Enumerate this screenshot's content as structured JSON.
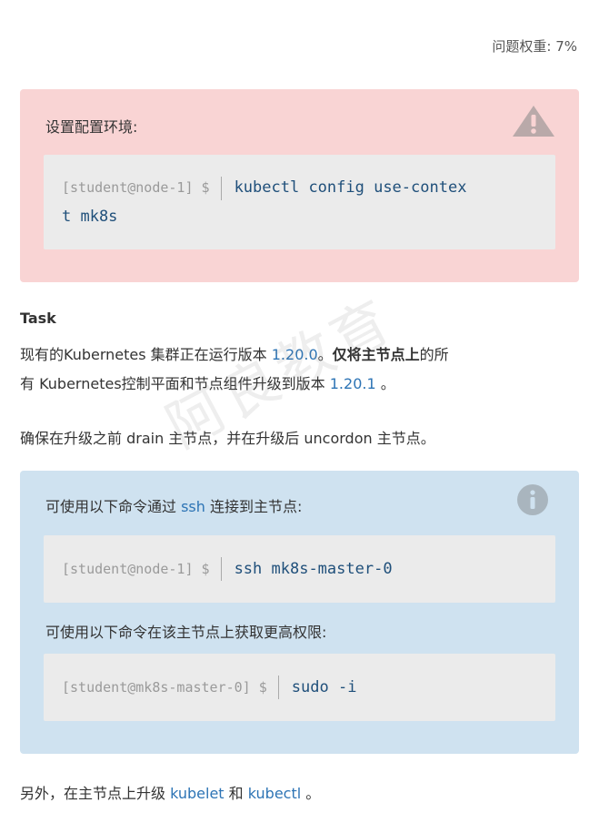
{
  "weight": "问题权重: 7%",
  "setup": {
    "title": "设置配置环境:",
    "prompt": "[student@node-1] $",
    "command_line1": "kubectl config use-contex",
    "command_line2": "t mk8s"
  },
  "task": {
    "heading": "Task",
    "p1_a": "现有的Kubernetes 集群正在运行版本 ",
    "p1_version_current": "1.20.0",
    "p1_b": "。",
    "p1_bold": "仅将主节点上",
    "p1_c": "的所",
    "p1_d": "有 Kubernetes控制平面和节点组件升级到版本 ",
    "p1_version_target": "1.20.1",
    "p1_e": " 。",
    "p2": "确保在升级之前 drain 主节点，并在升级后 uncordon 主节点。"
  },
  "info": {
    "title_a": "可使用以下命令通过 ",
    "title_link": "ssh",
    "title_b": " 连接到主节点:",
    "prompt1": "[student@node-1] $",
    "command1": "ssh mk8s-master-0",
    "subtitle": "可使用以下命令在该主节点上获取更高权限:",
    "prompt2": "[student@mk8s-master-0] $",
    "command2": "sudo -i"
  },
  "footer": {
    "a": "另外，在主节点上升级 ",
    "link1": "kubelet",
    "b": " 和 ",
    "link2": "kubectl",
    "c": " 。"
  },
  "watermark": "阿良教育",
  "colors": {
    "warn_bg": "#f9d4d4",
    "info_bg": "#cfe2f0",
    "link": "#2d74b5",
    "code_bg": "#ebebeb"
  }
}
